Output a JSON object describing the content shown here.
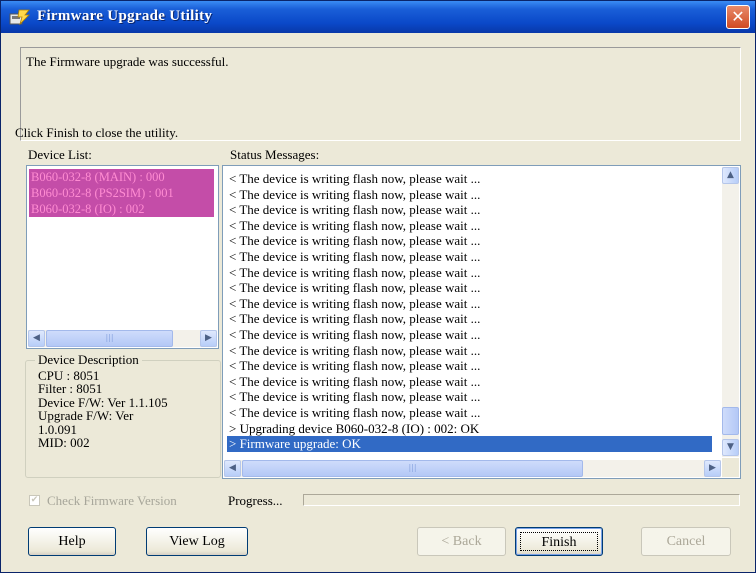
{
  "window": {
    "title": "Firmware Upgrade Utility",
    "close_glyph": "✕",
    "accent": "#0a48c8"
  },
  "messages": {
    "line1": "The Firmware upgrade was successful.",
    "line2": "Click Finish to close the utility."
  },
  "device_list": {
    "label": "Device List:",
    "items": [
      "B060-032-8 (MAIN) : 000",
      "B060-032-8 (PS2SIM) : 001",
      "B060-032-8 (IO) : 002"
    ],
    "selection_color": "#c44da8"
  },
  "device_description": {
    "title": "Device Description",
    "cpu": "CPU : 8051",
    "filter": "Filter : 8051",
    "device_fw": "Device F/W: Ver 1.1.105",
    "upgrade_fw_1": "Upgrade F/W: Ver",
    "upgrade_fw_2": "1.0.091",
    "mid": "MID: 002"
  },
  "status": {
    "label": "Status Messages:",
    "lines": [
      "< The device is writing flash now, please wait ...",
      "< The device is writing flash now, please wait ...",
      "< The device is writing flash now, please wait ...",
      "< The device is writing flash now, please wait ...",
      "< The device is writing flash now, please wait ...",
      "< The device is writing flash now, please wait ...",
      "< The device is writing flash now, please wait ...",
      "< The device is writing flash now, please wait ...",
      "< The device is writing flash now, please wait ...",
      "< The device is writing flash now, please wait ...",
      "< The device is writing flash now, please wait ...",
      "< The device is writing flash now, please wait ...",
      "< The device is writing flash now, please wait ...",
      "< The device is writing flash now, please wait ...",
      "< The device is writing flash now, please wait ...",
      "< The device is writing flash now, please wait ...",
      "> Upgrading device B060-032-8 (IO) : 002: OK",
      "> Firmware upgrade: OK"
    ],
    "selected_index": 17,
    "selection_color": "#316ac5"
  },
  "options": {
    "check_firmware_label": "Check Firmware Version",
    "check_firmware_checked": true,
    "progress_label": "Progress...",
    "progress": 0
  },
  "buttons": {
    "help": "Help",
    "view_log": "View Log",
    "back": "< Back",
    "finish": "Finish",
    "cancel": "Cancel"
  },
  "scroll_glyphs": {
    "left": "◀",
    "right": "▶",
    "up": "▲",
    "down": "▼",
    "grip": "|||"
  }
}
